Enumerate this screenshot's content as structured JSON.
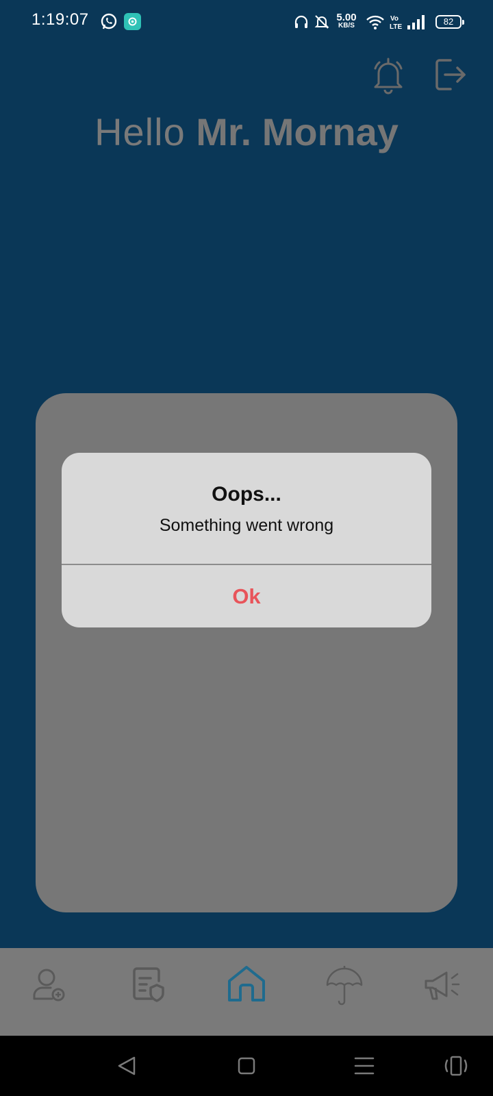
{
  "status_bar": {
    "time": "1:19:07",
    "network_speed_value": "5.00",
    "network_speed_unit": "KB/S",
    "battery": "82",
    "icons": [
      "whatsapp-icon",
      "app-notification-icon",
      "headset-icon",
      "bell-muted-icon",
      "wifi-icon",
      "volte-icon",
      "signal-icon",
      "battery-icon"
    ]
  },
  "header": {
    "greeting_prefix": "Hello",
    "greeting_name": "Mr. Mornay",
    "icons": [
      "bell-icon",
      "logout-icon"
    ]
  },
  "dialog": {
    "title": "Oops...",
    "message": "Something went wrong",
    "ok_label": "Ok"
  },
  "tab_bar": {
    "tabs": [
      {
        "icon": "add-user-icon",
        "active": false
      },
      {
        "icon": "policy-document-icon",
        "active": false
      },
      {
        "icon": "home-icon",
        "active": true
      },
      {
        "icon": "umbrella-icon",
        "active": false
      },
      {
        "icon": "megaphone-icon",
        "active": false
      }
    ]
  },
  "system_nav": {
    "buttons": [
      "back-icon",
      "home-square-icon",
      "recents-icon",
      "rotate-icon"
    ]
  },
  "colors": {
    "background": "#0a3757",
    "card": "#777777",
    "dialog": "#d9d9d9",
    "ok_text": "#e8545a",
    "active_tab": "#1f6b8e",
    "inactive_tab": "#5a5a5a"
  }
}
